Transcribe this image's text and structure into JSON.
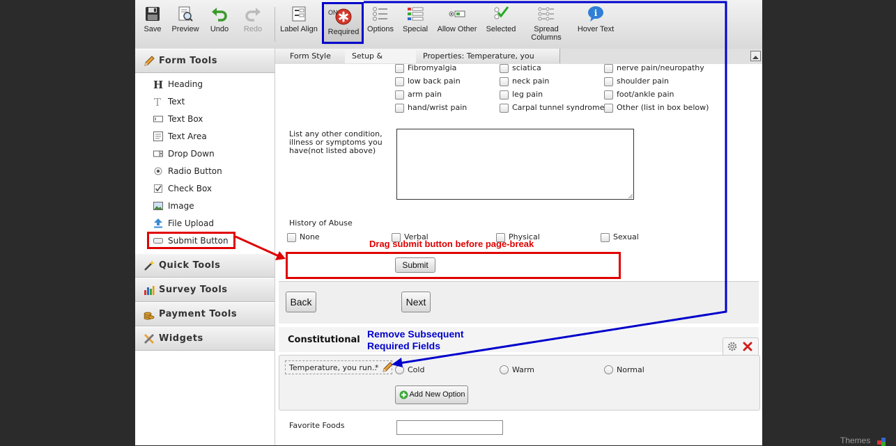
{
  "toolbar": {
    "save": "Save",
    "preview": "Preview",
    "undo": "Undo",
    "redo": "Redo",
    "label_align": "Label Align",
    "required_state": "ON",
    "required": "Required",
    "options": "Options",
    "special": "Special",
    "allow_other": "Allow Other",
    "selected": "Selected",
    "spread_columns_1": "Spread",
    "spread_columns_2": "Columns",
    "hover_text": "Hover Text"
  },
  "sidebar": {
    "form_tools": "Form Tools",
    "items": [
      "Heading",
      "Text",
      "Text Box",
      "Text Area",
      "Drop Down",
      "Radio Button",
      "Check Box",
      "Image",
      "File Upload",
      "Submit Button"
    ],
    "quick_tools": "Quick Tools",
    "survey_tools": "Survey Tools",
    "payment_tools": "Payment Tools",
    "widgets": "Widgets"
  },
  "tabs": {
    "form_style": "Form Style",
    "setup_embed": "Setup & Embed",
    "properties": "Properties: Temperature, you run.."
  },
  "conditions": {
    "col1": [
      "Fibromyalgia",
      "low back pain",
      "arm pain",
      "hand/wrist pain"
    ],
    "col2": [
      "sciatica",
      "neck pain",
      "leg pain",
      "Carpal tunnel syndrome"
    ],
    "col3": [
      "nerve pain/neuropathy",
      "shoulder pain",
      "foot/ankle pain",
      "Other (list in box below)"
    ]
  },
  "other_condition": {
    "line1": "List any other condition,",
    "line2": "illness or symptoms you",
    "line3": "have(not listed above)"
  },
  "abuse": {
    "label": "History of Abuse",
    "options": [
      "None",
      "Verbal",
      "Physical",
      "Sexual"
    ]
  },
  "submit_label": "Submit",
  "back_label": "Back",
  "next_label": "Next",
  "section_title": "Constitutional",
  "temperature": {
    "label": "Temperature, you run..",
    "required_mark": "*",
    "options": [
      "Cold",
      "Warm",
      "Normal"
    ]
  },
  "add_option_label": "Add New Option",
  "favorite_foods": "Favorite Foods",
  "annotations": {
    "drag_submit": "Drag submit button before page-break",
    "remove_line1": "Remove Subsequent",
    "remove_line2": "Required Fields"
  },
  "themes_label": "Themes",
  "colors": {
    "annotation_red": "#e00000",
    "annotation_blue": "#0000cc"
  }
}
